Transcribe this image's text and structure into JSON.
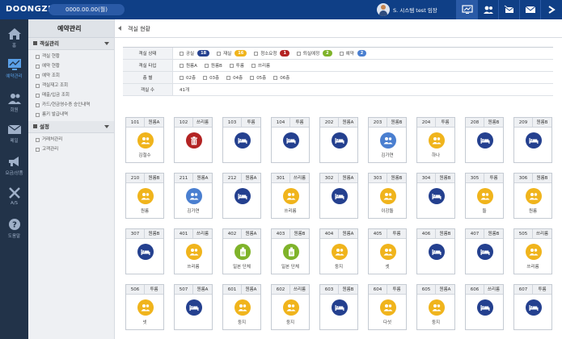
{
  "topbar": {
    "logo": "DOONGZI",
    "balance": "0000.00.00(월)",
    "user": "S. 시스템 test 임장",
    "icons": [
      "monitor-icon",
      "users-icon",
      "mail-broadcast-icon",
      "mail-icon",
      "share-icon"
    ]
  },
  "nav": [
    {
      "label": "홈",
      "icon": "home-icon"
    },
    {
      "label": "예약관리",
      "icon": "monitor-icon"
    },
    {
      "label": "회원",
      "icon": "users-icon"
    },
    {
      "label": "메일",
      "icon": "mail-icon"
    },
    {
      "label": "요금/상품",
      "icon": "megaphone-icon"
    },
    {
      "label": "A/S",
      "icon": "tools-icon"
    },
    {
      "label": "도움말",
      "icon": "help-icon"
    }
  ],
  "sidebar": {
    "title": "예약관리",
    "sections": [
      {
        "label": "객실관리",
        "items": [
          "객실 현황",
          "예약 현황",
          "예약 조회",
          "객실재고 조회",
          "매출/입금 조회",
          "카드/현금영수증 승인내역",
          "룸키 발급내역"
        ]
      },
      {
        "label": "설정",
        "items": [
          "거래처관리",
          "고객관리"
        ]
      }
    ]
  },
  "header": {
    "title": "객실 현황"
  },
  "filter": {
    "status_label": "객실 상태",
    "status_options": [
      {
        "label": "공실",
        "count": "18",
        "color": "#24408f"
      },
      {
        "label": "재실",
        "count": "16",
        "color": "#f0b41c"
      },
      {
        "label": "청소요청",
        "count": "1",
        "color": "#b32323"
      },
      {
        "label": "퇴실예정",
        "count": "2",
        "color": "#7fb32a"
      },
      {
        "label": "예약",
        "count": "2",
        "color": "#4a7fd0"
      }
    ],
    "type_label": "객실 타입",
    "type_options": [
      "원룸A",
      "원룸B",
      "투룸",
      "쓰리룸"
    ],
    "floor_label": "층 별",
    "floor_options": [
      "02층",
      "03층",
      "04층",
      "05층",
      "06층"
    ],
    "count_label": "객실 수",
    "count_value": "41개"
  },
  "colors": {
    "vacant": "#24408f",
    "occupied": "#f0b41c",
    "clean": "#b32323",
    "checkout": "#7fb32a",
    "reserved": "#4a7fd0"
  },
  "rooms": [
    {
      "no": "101",
      "type": "원룸A",
      "status": "occupied",
      "name": "김철수"
    },
    {
      "no": "102",
      "type": "쓰리룸",
      "status": "clean",
      "name": ""
    },
    {
      "no": "103",
      "type": "투룸",
      "status": "vacant",
      "name": ""
    },
    {
      "no": "104",
      "type": "투룸",
      "status": "vacant",
      "name": ""
    },
    {
      "no": "202",
      "type": "원룸A",
      "status": "vacant",
      "name": ""
    },
    {
      "no": "203",
      "type": "원룸B",
      "status": "reserved",
      "name": "김가연"
    },
    {
      "no": "204",
      "type": "투룸",
      "status": "occupied",
      "name": "하나"
    },
    {
      "no": "208",
      "type": "원룸B",
      "status": "vacant",
      "name": ""
    },
    {
      "no": "209",
      "type": "원룸B",
      "status": "vacant",
      "name": ""
    },
    {
      "no": "210",
      "type": "원룸B",
      "status": "occupied",
      "name": "원룸"
    },
    {
      "no": "211",
      "type": "원룸A",
      "status": "reserved",
      "name": "김가연"
    },
    {
      "no": "212",
      "type": "원룸A",
      "status": "vacant",
      "name": ""
    },
    {
      "no": "301",
      "type": "쓰리룸",
      "status": "occupied",
      "name": "쓰리룸"
    },
    {
      "no": "302",
      "type": "원룸A",
      "status": "vacant",
      "name": ""
    },
    {
      "no": "303",
      "type": "원룸B",
      "status": "occupied",
      "name": "이강돌"
    },
    {
      "no": "304",
      "type": "원룸B",
      "status": "vacant",
      "name": ""
    },
    {
      "no": "305",
      "type": "투룸",
      "status": "occupied",
      "name": "둘"
    },
    {
      "no": "306",
      "type": "원룸B",
      "status": "occupied",
      "name": "원룸"
    },
    {
      "no": "307",
      "type": "원룸B",
      "status": "vacant",
      "name": ""
    },
    {
      "no": "401",
      "type": "쓰리룸",
      "status": "occupied",
      "name": "쓰리룸"
    },
    {
      "no": "402",
      "type": "원룸A",
      "status": "checkout",
      "name": "일본 단체"
    },
    {
      "no": "403",
      "type": "원룸B",
      "status": "checkout",
      "name": "일본 단체"
    },
    {
      "no": "404",
      "type": "원룸A",
      "status": "occupied",
      "name": "둥지"
    },
    {
      "no": "405",
      "type": "투룸",
      "status": "occupied",
      "name": "셋"
    },
    {
      "no": "406",
      "type": "원룸B",
      "status": "vacant",
      "name": ""
    },
    {
      "no": "407",
      "type": "원룸B",
      "status": "vacant",
      "name": ""
    },
    {
      "no": "505",
      "type": "쓰리룸",
      "status": "occupied",
      "name": "쓰리룸"
    },
    {
      "no": "506",
      "type": "투룸",
      "status": "occupied",
      "name": "넷"
    },
    {
      "no": "507",
      "type": "원룸A",
      "status": "vacant",
      "name": ""
    },
    {
      "no": "601",
      "type": "원룸A",
      "status": "occupied",
      "name": "둥지"
    },
    {
      "no": "602",
      "type": "쓰리룸",
      "status": "occupied",
      "name": "둥지"
    },
    {
      "no": "603",
      "type": "원룸B",
      "status": "vacant",
      "name": ""
    },
    {
      "no": "604",
      "type": "투룸",
      "status": "occupied",
      "name": "다섯"
    },
    {
      "no": "605",
      "type": "원룸A",
      "status": "occupied",
      "name": "둥지"
    },
    {
      "no": "606",
      "type": "쓰리룸",
      "status": "vacant",
      "name": ""
    },
    {
      "no": "607",
      "type": "투룸",
      "status": "vacant",
      "name": ""
    }
  ]
}
